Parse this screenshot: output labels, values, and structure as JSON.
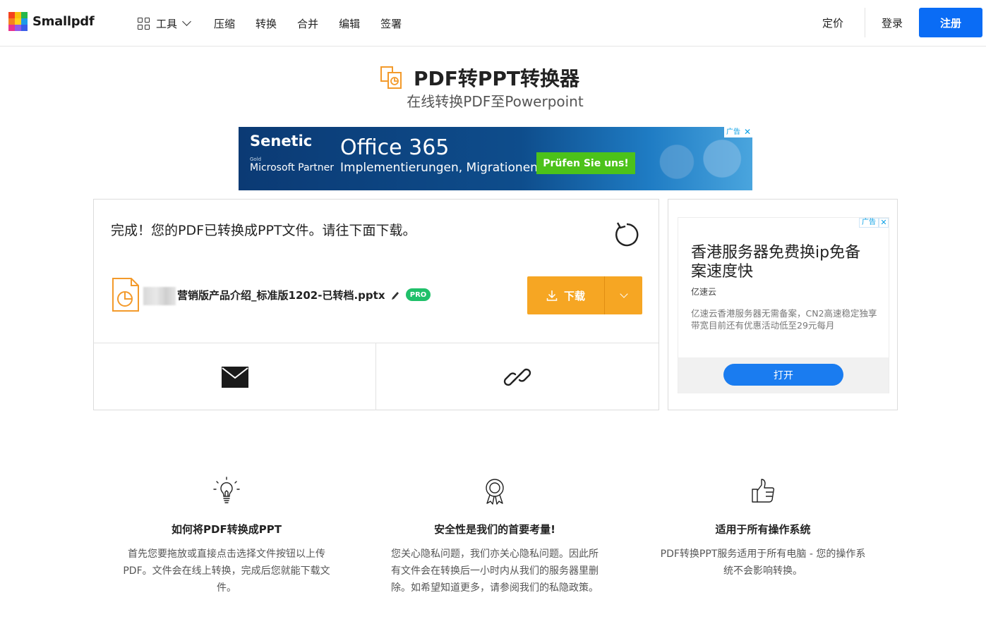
{
  "header": {
    "brand": "Smallpdf",
    "tools_label": "工具",
    "nav": [
      "压缩",
      "转换",
      "合并",
      "编辑",
      "签署"
    ],
    "pricing": "定价",
    "login": "登录",
    "signup": "注册"
  },
  "page": {
    "title": "PDF转PPT转换器",
    "subtitle": "在线转换PDF至Powerpoint"
  },
  "ad_banner": {
    "brand": "Senetic",
    "gold": "Gold",
    "partner": "Microsoft Partner",
    "product": "Office 365",
    "tagline": "Implementierungen, Migrationen.",
    "cta": "Prüfen Sie uns!",
    "tag": "广告",
    "close": "✕"
  },
  "result": {
    "message": "完成！您的PDF已转换成PPT文件。请往下面下载。",
    "file_name": "营销版产品介绍_标准版1202-已转档.pptx",
    "badge": "PRO",
    "download": "下载"
  },
  "side_ad": {
    "tag": "广告",
    "close": "✕",
    "headline": "香港服务器免费换ip免备案速度快",
    "brand": "亿速云",
    "description": "亿速云香港服务器无需备案，CN2高速稳定独享带宽目前还有优惠活动低至29元每月",
    "button": "打开"
  },
  "features": [
    {
      "title": "如何将PDF转换成PPT",
      "text": "首先您要拖放或直接点击选择文件按钮以上传PDF。文件会在线上转换，完成后您就能下载文件。"
    },
    {
      "title": "安全性是我们的首要考量!",
      "text": "您关心隐私问题，我们亦关心隐私问题。因此所有文件会在转换后一小时内从我们的服务器里删除。如希望知道更多，请参阅我们的私隐政策。"
    },
    {
      "title": "适用于所有操作系统",
      "text": "PDF转换PPT服务适用于所有电脑 - 您的操作系统不会影响转换。"
    }
  ],
  "colors": {
    "primary": "#0a6cf5",
    "download": "#f6a623",
    "pro": "#20c06a",
    "ppt_orange": "#f39a2b"
  },
  "icons": [
    "grid-icon",
    "chevron-down-icon",
    "ppt-file-icon",
    "refresh-icon",
    "download-icon",
    "pencil-icon",
    "email-icon",
    "link-icon",
    "lightbulb-icon",
    "award-icon",
    "thumbs-up-icon"
  ]
}
